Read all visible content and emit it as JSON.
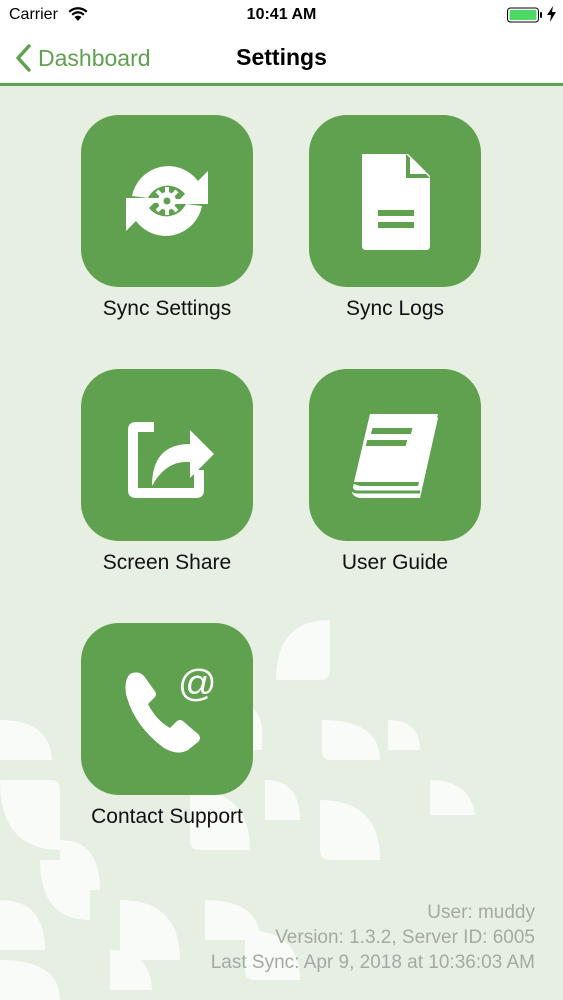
{
  "status_bar": {
    "carrier": "Carrier",
    "time": "10:41 AM",
    "wifi_icon": "wifi-icon",
    "battery_icon": "battery-full-icon",
    "charging_icon": "bolt-icon"
  },
  "nav": {
    "back_label": "Dashboard",
    "back_icon": "chevron-left-icon",
    "title": "Settings"
  },
  "tiles": [
    {
      "label": "Sync Settings",
      "icon": "sync-settings-icon"
    },
    {
      "label": "Sync Logs",
      "icon": "document-icon"
    },
    {
      "label": "Screen Share",
      "icon": "share-icon"
    },
    {
      "label": "User Guide",
      "icon": "book-icon"
    },
    {
      "label": "Contact Support",
      "icon": "phone-at-icon"
    }
  ],
  "footer": {
    "user": "User: muddy",
    "version": "Version: 1.3.2, Server ID: 6005",
    "last_sync": "Last Sync: Apr 9, 2018 at 10:36:03 AM"
  },
  "colors": {
    "accent": "#5fa14f",
    "background": "#e6efe2",
    "footer_text": "#a4aaa3"
  }
}
